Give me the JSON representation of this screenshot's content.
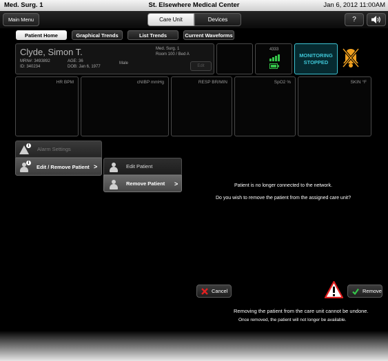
{
  "header": {
    "unit": "Med. Surg. 1",
    "hospital": "St. Elsewhere Medical Center",
    "datetime": "Jan 6, 2012  11:00AM"
  },
  "nav": {
    "main_menu": "Main Menu",
    "segments": [
      {
        "label": "Care Unit",
        "active": true
      },
      {
        "label": "Devices",
        "active": false
      }
    ],
    "help": "?"
  },
  "tabs": [
    "Patient Home",
    "Graphical Trends",
    "List Trends",
    "Current Waveforms"
  ],
  "patient": {
    "name": "Clyde, Simon T.",
    "mrn": "MRN#: 3493892",
    "id": "ID: 340234",
    "age": "AGE: 36",
    "dob": "DOB: Jan 6, 1977",
    "sex": "Male",
    "unit": "Med. Surg. 1",
    "room": "Room 100 / Bed A",
    "edit": "Edit"
  },
  "device": {
    "number": "4333"
  },
  "monitoring": {
    "line1": "MONITORING",
    "line2": "STOPPED"
  },
  "vitals": [
    "HR BPM",
    "cNIBP mmHg",
    "RESP BR/MIN",
    "SpO2 %",
    "SKIN °F"
  ],
  "menu": {
    "alarm_settings": "Alarm Settings",
    "edit_remove": "Edit / Remove Patient",
    "edit_patient": "Edit Patient",
    "remove_patient": "Remove Patient",
    "chevron": ">",
    "info": "i"
  },
  "dialog": {
    "line1": "Patient is no longer connected to the network.",
    "line2": "Do you wish to remove the patient from the assigned care unit?",
    "cancel": "Cancel",
    "remove": "Remove",
    "warning1": "Removing the patient from the care unit cannot be undone.",
    "warning2": "Once removed, the patient will not longer be available."
  },
  "colors": {
    "accent": "#3ec6d6",
    "ok": "#35c64a",
    "alarm": "#f0a020",
    "danger": "#e02020"
  }
}
